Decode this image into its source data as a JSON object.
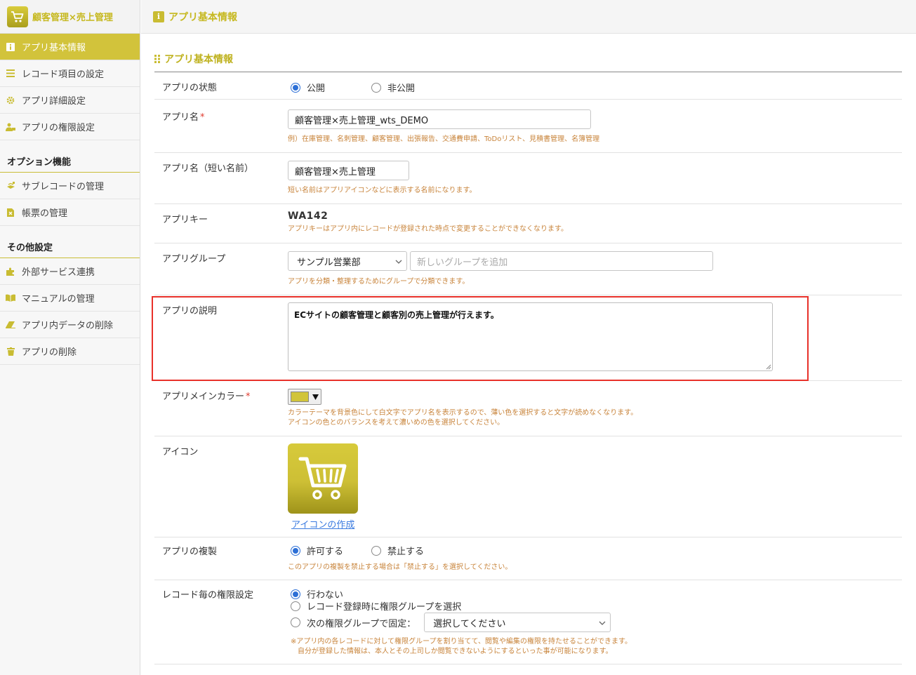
{
  "app": {
    "title": "顧客管理×売上管理",
    "logo_icon": "cart-icon"
  },
  "sidebar": {
    "items": [
      {
        "label": "アプリ基本情報",
        "icon": "info-icon",
        "active": true
      },
      {
        "label": "レコード項目の設定",
        "icon": "list-icon"
      },
      {
        "label": "アプリ詳細設定",
        "icon": "gear-icon"
      },
      {
        "label": "アプリの権限設定",
        "icon": "user-lock-icon"
      }
    ],
    "option_section": "オプション機能",
    "option_items": [
      {
        "label": "サブレコードの管理",
        "icon": "subrecord-icon"
      },
      {
        "label": "帳票の管理",
        "icon": "report-icon"
      }
    ],
    "other_section": "その他設定",
    "other_items": [
      {
        "label": "外部サービス連携",
        "icon": "puzzle-icon"
      },
      {
        "label": "マニュアルの管理",
        "icon": "book-icon"
      },
      {
        "label": "アプリ内データの削除",
        "icon": "eraser-icon"
      },
      {
        "label": "アプリの削除",
        "icon": "trash-icon"
      }
    ]
  },
  "header": {
    "title": "アプリ基本情報"
  },
  "section": {
    "title": "アプリ基本情報"
  },
  "form": {
    "status": {
      "label": "アプリの状態",
      "opt_public": "公開",
      "opt_private": "非公開",
      "selected": "公開"
    },
    "name": {
      "label": "アプリ名",
      "required_mark": "*",
      "value": "顧客管理×売上管理_wts_DEMO",
      "hint": "例）在庫管理、名刺管理、顧客管理、出張報告、交通費申請、ToDoリスト、見積書管理、名簿管理"
    },
    "short_name": {
      "label": "アプリ名（短い名前）",
      "value": "顧客管理×売上管理",
      "hint": "短い名前はアプリアイコンなどに表示する名前になります。"
    },
    "key": {
      "label": "アプリキー",
      "value": "WA142",
      "hint": "アプリキーはアプリ内にレコードが登録された時点で変更することができなくなります。"
    },
    "group": {
      "label": "アプリグループ",
      "selected": "サンプル営業部",
      "new_placeholder": "新しいグループを追加",
      "hint": "アプリを分類・整理するためにグループで分類できます。"
    },
    "description": {
      "label": "アプリの説明",
      "value": "ECサイトの顧客管理と顧客別の売上管理が行えます。"
    },
    "color": {
      "label": "アプリメインカラー",
      "required_mark": "*",
      "value": "#d1c43a",
      "hint1": "カラーテーマを背景色にして白文字でアプリ名を表示するので、薄い色を選択すると文字が読めなくなります。",
      "hint2": "アイコンの色とのバランスを考えて濃いめの色を選択してください。"
    },
    "icon": {
      "label": "アイコン",
      "link": "アイコンの作成",
      "icon": "cart-icon"
    },
    "duplicate": {
      "label": "アプリの複製",
      "opt_allow": "許可する",
      "opt_deny": "禁止する",
      "selected": "許可する",
      "hint": "このアプリの複製を禁止する場合は「禁止する」を選択してください。"
    },
    "record_permission": {
      "label": "レコード毎の権限設定",
      "opt_none": "行わない",
      "opt_on_register": "レコード登録時に権限グループを選択",
      "opt_fixed": "次の権限グループで固定：",
      "select_placeholder": "選択してください",
      "selected": "行わない",
      "hint1": "※アプリ内の各レコードに対して権限グループを割り当てて、閲覧や編集の権限を持たせることができます。",
      "hint2": "自分が登録した情報は、本人とその上司しか閲覧できないようにするといった事が可能になります。"
    }
  }
}
